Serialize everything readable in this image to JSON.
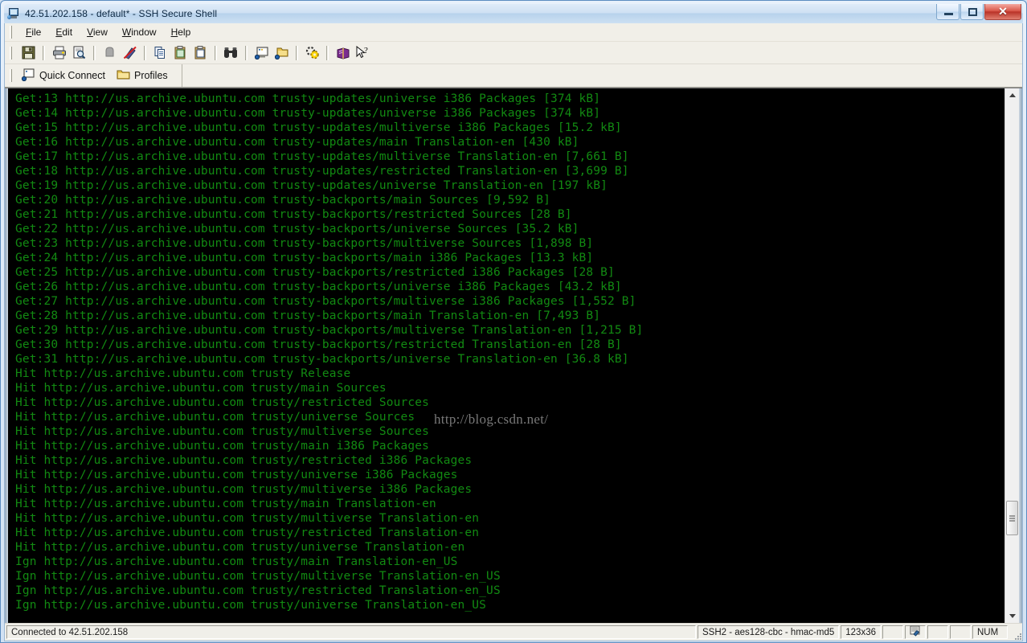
{
  "window": {
    "title": "42.51.202.158 - default* - SSH Secure Shell",
    "icon": "ssh-terminal-icon",
    "buttons": {
      "minimize": "minimize-button",
      "restore": "restore-button",
      "close": "✕"
    }
  },
  "menubar": {
    "items": [
      {
        "label": "File",
        "accel": "F"
      },
      {
        "label": "Edit",
        "accel": "E"
      },
      {
        "label": "View",
        "accel": "V"
      },
      {
        "label": "Window",
        "accel": "W"
      },
      {
        "label": "Help",
        "accel": "H"
      }
    ]
  },
  "toolbar": {
    "buttons": [
      {
        "name": "save-icon",
        "tip": "Save"
      },
      {
        "name": "print-icon",
        "tip": "Print"
      },
      {
        "name": "print-preview-icon",
        "tip": "Print Preview"
      },
      {
        "name": "upload-icon",
        "tip": "Upload Dialog"
      },
      {
        "name": "download-disabled-icon",
        "tip": "Download Dialog"
      },
      {
        "name": "copy-icon",
        "tip": "Copy"
      },
      {
        "name": "paste-icon",
        "tip": "Paste"
      },
      {
        "name": "copy-paste-icon",
        "tip": "Copy and Paste"
      },
      {
        "name": "find-icon",
        "tip": "Find"
      },
      {
        "name": "new-terminal-icon",
        "tip": "New Terminal"
      },
      {
        "name": "new-file-transfer-icon",
        "tip": "New File Transfer"
      },
      {
        "name": "settings-icon",
        "tip": "Settings"
      },
      {
        "name": "help-book-icon",
        "tip": "Help"
      },
      {
        "name": "context-help-icon",
        "tip": "Context Help"
      }
    ]
  },
  "quickbar": {
    "quick_connect": "Quick Connect",
    "profiles": "Profiles"
  },
  "terminal": {
    "watermark": "http://blog.csdn.net/",
    "foreground": "#128a12",
    "background": "#000000",
    "lines": [
      "Get:13 http://us.archive.ubuntu.com trusty-updates/universe i386 Packages [374 kB]",
      "Get:14 http://us.archive.ubuntu.com trusty-updates/universe i386 Packages [374 kB]",
      "Get:15 http://us.archive.ubuntu.com trusty-updates/multiverse i386 Packages [15.2 kB]",
      "Get:16 http://us.archive.ubuntu.com trusty-updates/main Translation-en [430 kB]",
      "Get:17 http://us.archive.ubuntu.com trusty-updates/multiverse Translation-en [7,661 B]",
      "Get:18 http://us.archive.ubuntu.com trusty-updates/restricted Translation-en [3,699 B]",
      "Get:19 http://us.archive.ubuntu.com trusty-updates/universe Translation-en [197 kB]",
      "Get:20 http://us.archive.ubuntu.com trusty-backports/main Sources [9,592 B]",
      "Get:21 http://us.archive.ubuntu.com trusty-backports/restricted Sources [28 B]",
      "Get:22 http://us.archive.ubuntu.com trusty-backports/universe Sources [35.2 kB]",
      "Get:23 http://us.archive.ubuntu.com trusty-backports/multiverse Sources [1,898 B]",
      "Get:24 http://us.archive.ubuntu.com trusty-backports/main i386 Packages [13.3 kB]",
      "Get:25 http://us.archive.ubuntu.com trusty-backports/restricted i386 Packages [28 B]",
      "Get:26 http://us.archive.ubuntu.com trusty-backports/universe i386 Packages [43.2 kB]",
      "Get:27 http://us.archive.ubuntu.com trusty-backports/multiverse i386 Packages [1,552 B]",
      "Get:28 http://us.archive.ubuntu.com trusty-backports/main Translation-en [7,493 B]",
      "Get:29 http://us.archive.ubuntu.com trusty-backports/multiverse Translation-en [1,215 B]",
      "Get:30 http://us.archive.ubuntu.com trusty-backports/restricted Translation-en [28 B]",
      "Get:31 http://us.archive.ubuntu.com trusty-backports/universe Translation-en [36.8 kB]",
      "Hit http://us.archive.ubuntu.com trusty Release",
      "Hit http://us.archive.ubuntu.com trusty/main Sources",
      "Hit http://us.archive.ubuntu.com trusty/restricted Sources",
      "Hit http://us.archive.ubuntu.com trusty/universe Sources",
      "Hit http://us.archive.ubuntu.com trusty/multiverse Sources",
      "Hit http://us.archive.ubuntu.com trusty/main i386 Packages",
      "Hit http://us.archive.ubuntu.com trusty/restricted i386 Packages",
      "Hit http://us.archive.ubuntu.com trusty/universe i386 Packages",
      "Hit http://us.archive.ubuntu.com trusty/multiverse i386 Packages",
      "Hit http://us.archive.ubuntu.com trusty/main Translation-en",
      "Hit http://us.archive.ubuntu.com trusty/multiverse Translation-en",
      "Hit http://us.archive.ubuntu.com trusty/restricted Translation-en",
      "Hit http://us.archive.ubuntu.com trusty/universe Translation-en",
      "Ign http://us.archive.ubuntu.com trusty/main Translation-en_US",
      "Ign http://us.archive.ubuntu.com trusty/multiverse Translation-en_US",
      "Ign http://us.archive.ubuntu.com trusty/restricted Translation-en_US",
      "Ign http://us.archive.ubuntu.com trusty/universe Translation-en_US"
    ]
  },
  "statusbar": {
    "connection": "Connected to 42.51.202.158",
    "cipher": "SSH2 - aes128-cbc - hmac-md5",
    "size": "123x36",
    "indicator_icon": "encryption-icon",
    "num_lock": "NUM"
  }
}
